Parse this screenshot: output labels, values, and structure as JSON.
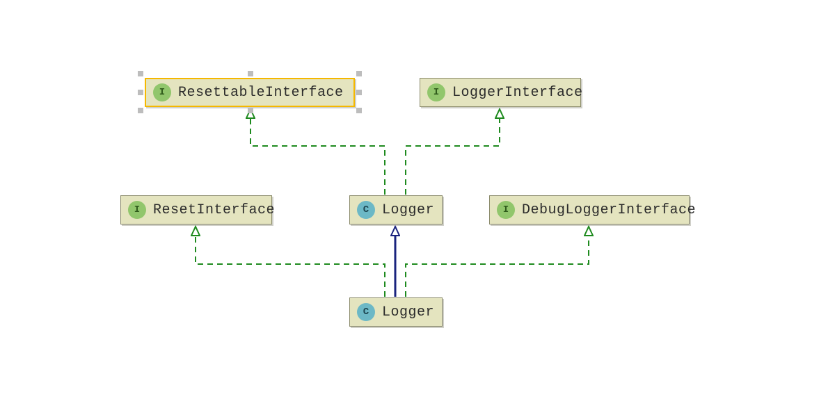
{
  "diagram": {
    "nodes": {
      "resettable_interface": {
        "kind": "I",
        "label": "ResettableInterface",
        "selected": true
      },
      "logger_interface": {
        "kind": "I",
        "label": "LoggerInterface",
        "selected": false
      },
      "reset_interface": {
        "kind": "I",
        "label": "ResetInterface",
        "selected": false
      },
      "logger_top": {
        "kind": "C",
        "label": "Logger",
        "selected": false
      },
      "debug_logger_interface": {
        "kind": "I",
        "label": "DebugLoggerInterface",
        "selected": false
      },
      "logger_bottom": {
        "kind": "C",
        "label": "Logger",
        "selected": false
      }
    },
    "relations": [
      {
        "from": "logger_top",
        "to": "resettable_interface",
        "type": "implements"
      },
      {
        "from": "logger_top",
        "to": "logger_interface",
        "type": "implements"
      },
      {
        "from": "logger_bottom",
        "to": "reset_interface",
        "type": "implements"
      },
      {
        "from": "logger_bottom",
        "to": "debug_logger_interface",
        "type": "implements"
      },
      {
        "from": "logger_bottom",
        "to": "logger_top",
        "type": "extends"
      }
    ],
    "legend": {
      "I": "Interface",
      "C": "Class",
      "implements_style": "dashed green arrow, hollow head",
      "extends_style": "solid navy arrow, hollow head"
    }
  }
}
